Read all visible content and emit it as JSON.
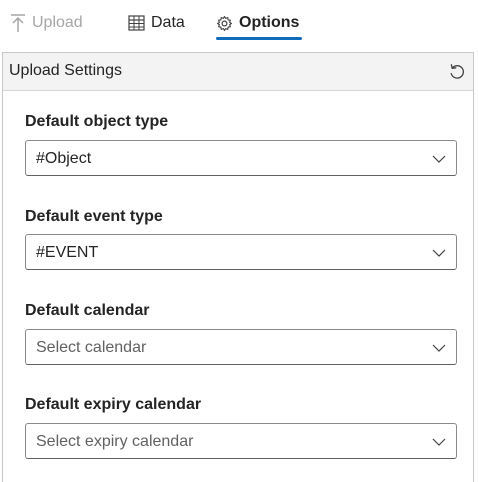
{
  "tabs": {
    "upload": {
      "label": "Upload",
      "icon": "upload-icon",
      "disabled": true
    },
    "data": {
      "label": "Data",
      "icon": "table-icon"
    },
    "options": {
      "label": "Options",
      "icon": "gear-icon",
      "selected": true
    }
  },
  "panel": {
    "title": "Upload Settings",
    "reset_icon": "reset-icon"
  },
  "fields": {
    "object_type": {
      "label": "Default object type",
      "value": "#Object"
    },
    "event_type": {
      "label": "Default event type",
      "value": "#EVENT"
    },
    "calendar": {
      "label": "Default calendar",
      "placeholder": "Select calendar"
    },
    "expiry_calendar": {
      "label": "Default expiry calendar",
      "placeholder": "Select expiry calendar"
    }
  },
  "colors": {
    "accent": "#0f6cbd",
    "disabled_text": "#a6a6a6",
    "header_bg": "#f3f3f3"
  }
}
